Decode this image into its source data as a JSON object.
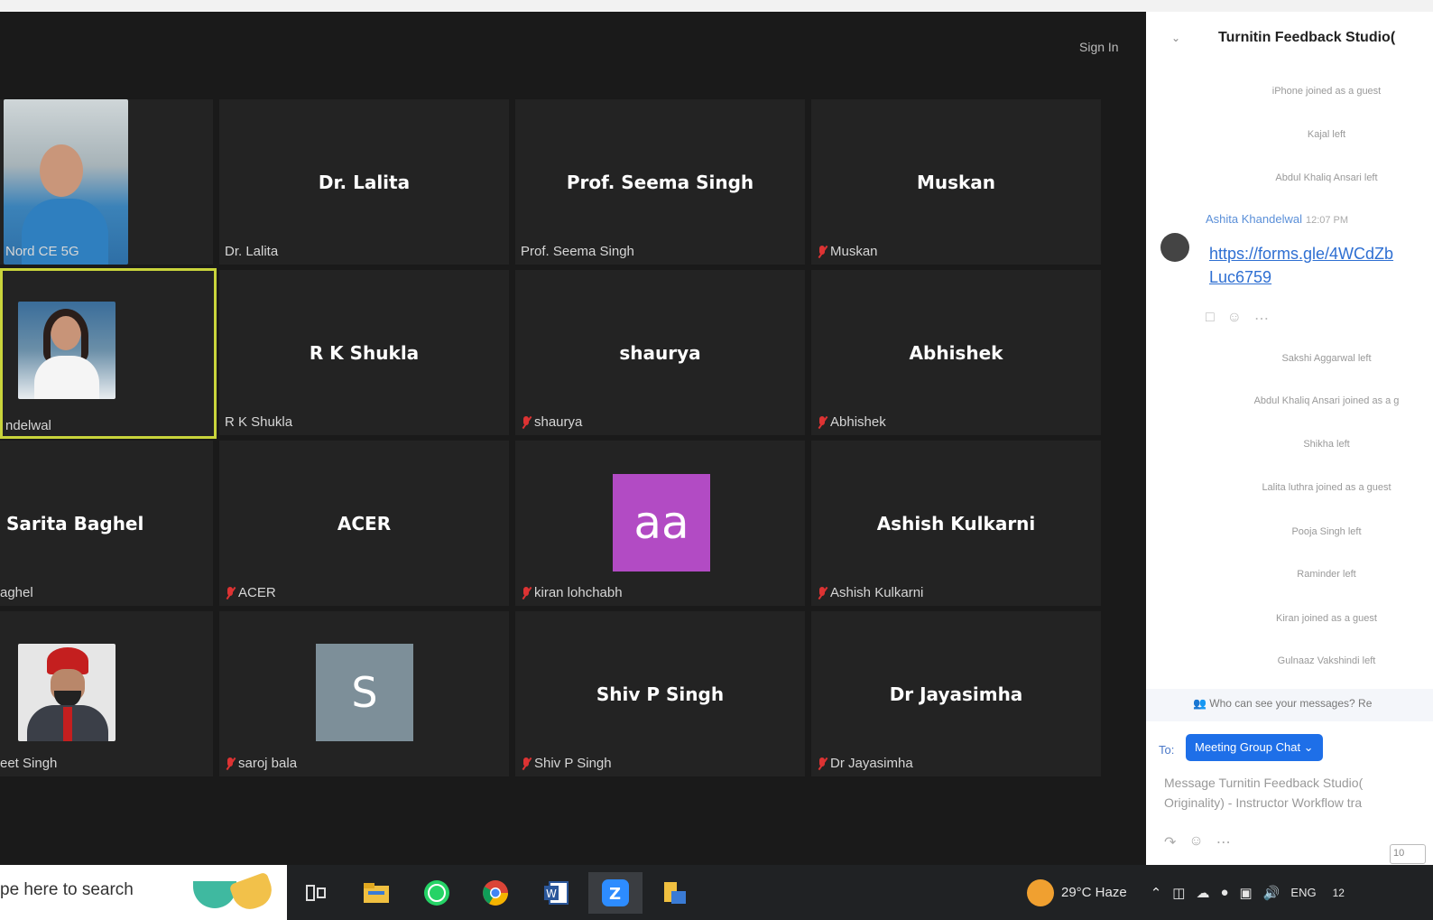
{
  "window": {
    "sign_in": "Sign In"
  },
  "tiles": [
    {
      "center": "",
      "label": "Nord CE 5G",
      "muted": false,
      "kind": "photo"
    },
    {
      "center": "Dr. Lalita",
      "label": "Dr. Lalita",
      "muted": false
    },
    {
      "center": "Prof. Seema Singh",
      "label": "Prof. Seema Singh",
      "muted": false
    },
    {
      "center": "Muskan",
      "label": "Muskan",
      "muted": true
    },
    {
      "center": "",
      "label": "ndelwal",
      "muted": false,
      "kind": "photo",
      "active": true
    },
    {
      "center": "R K Shukla",
      "label": "R K Shukla",
      "muted": false
    },
    {
      "center": "shaurya",
      "label": "shaurya",
      "muted": true
    },
    {
      "center": "Abhishek",
      "label": "Abhishek",
      "muted": true
    },
    {
      "center": "Sarita Baghel",
      "label": "aghel",
      "muted": false
    },
    {
      "center": "ACER",
      "label": "ACER",
      "muted": true
    },
    {
      "center": "",
      "label": "kiran lohchabh",
      "muted": true,
      "avatar": "aa",
      "avatar_color": "#b24bc4"
    },
    {
      "center": "Ashish Kulkarni",
      "label": "Ashish Kulkarni",
      "muted": true
    },
    {
      "center": "",
      "label": "eet Singh",
      "muted": false,
      "kind": "photo"
    },
    {
      "center": "",
      "label": "saroj bala",
      "muted": true,
      "avatar": "S",
      "avatar_color": "#7d8f99"
    },
    {
      "center": "Shiv P Singh",
      "label": "Shiv P Singh",
      "muted": true
    },
    {
      "center": "Dr Jayasimha",
      "label": "Dr Jayasimha",
      "muted": true
    }
  ],
  "chat": {
    "title": "Turnitin Feedback Studio(",
    "system_messages": [
      "iPhone joined as a guest",
      "Kajal left",
      "Abdul Khaliq Ansari left",
      "Sakshi Aggarwal left",
      "Abdul Khaliq Ansari joined as a g",
      "Shikha left",
      "Lalita luthra joined as a guest",
      "Pooja Singh left",
      "Raminder left",
      "Kiran joined as a guest",
      "Gulnaaz Vakshindi left"
    ],
    "message": {
      "sender": "Ashita Khandelwal",
      "time": "12:07 PM",
      "link": "https://forms.gle/4WCdZb Luc6759"
    },
    "who_can_see": "Who can see your messages? Re",
    "to_label": "To:",
    "recipient": "Meeting Group Chat ⌄",
    "placeholder_line1": "Message Turnitin Feedback Studio(",
    "placeholder_line2": "Originality) - Instructor Workflow tra",
    "send_box": "10"
  },
  "taskbar": {
    "search_placeholder": "pe here to search",
    "weather": "29°C  Haze",
    "lang": "ENG",
    "clock": "12"
  }
}
